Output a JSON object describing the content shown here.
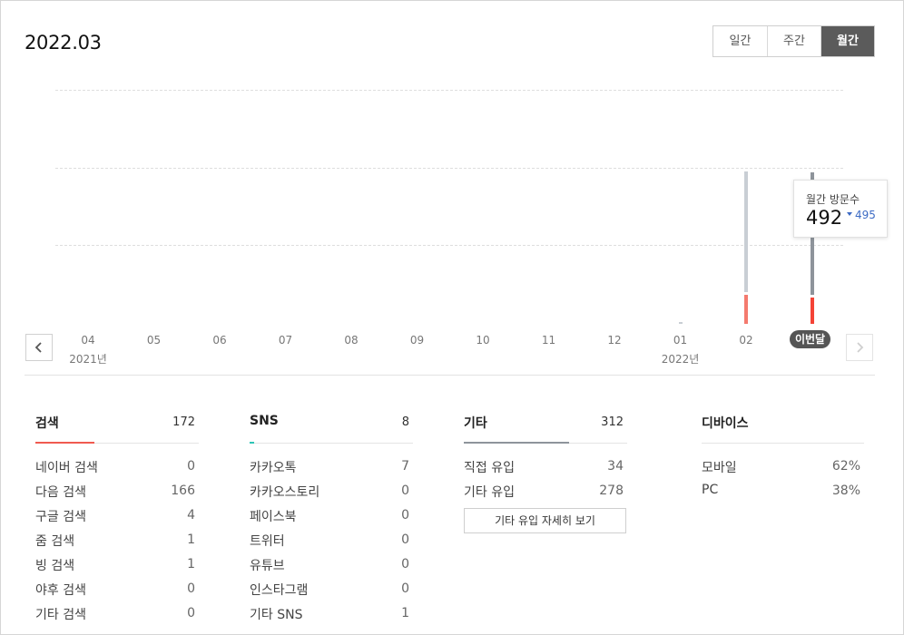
{
  "header": {
    "period": "2022.03",
    "tabs": [
      {
        "label": "일간",
        "active": false
      },
      {
        "label": "주간",
        "active": false
      },
      {
        "label": "월간",
        "active": true
      }
    ]
  },
  "chart_data": {
    "type": "bar",
    "categories": [
      "04",
      "05",
      "06",
      "07",
      "08",
      "09",
      "10",
      "11",
      "12",
      "01",
      "02",
      "이번달"
    ],
    "year_labels": {
      "04": "2021년",
      "01": "2022년"
    },
    "series": [
      {
        "color": "#c9ced4",
        "values": [
          0,
          0,
          0,
          0,
          0,
          0,
          0,
          0,
          0,
          1,
          495,
          492
        ]
      },
      {
        "color": "#f47a6e",
        "values": [
          0,
          0,
          0,
          0,
          0,
          0,
          0,
          0,
          0,
          0,
          95,
          85
        ]
      }
    ],
    "highlight_color": "#f44336",
    "current_bar_color": "#8e949b",
    "grid": true
  },
  "tooltip": {
    "label": "월간 방문수",
    "value": "492",
    "delta": "495"
  },
  "current_badge": "이번달",
  "nav": {
    "prev": "chevron-left",
    "next": "chevron-right"
  },
  "sections": {
    "search": {
      "title": "검색",
      "total": "172",
      "accent": "#f05a4f",
      "rows": [
        {
          "label": "네이버 검색",
          "value": "0"
        },
        {
          "label": "다음 검색",
          "value": "166"
        },
        {
          "label": "구글 검색",
          "value": "4"
        },
        {
          "label": "줌 검색",
          "value": "1"
        },
        {
          "label": "빙 검색",
          "value": "1"
        },
        {
          "label": "야후 검색",
          "value": "0"
        },
        {
          "label": "기타 검색",
          "value": "0"
        }
      ]
    },
    "sns": {
      "title": "SNS",
      "total": "8",
      "accent": "#2ec4b6",
      "rows": [
        {
          "label": "카카오톡",
          "value": "7"
        },
        {
          "label": "카카오스토리",
          "value": "0"
        },
        {
          "label": "페이스북",
          "value": "0"
        },
        {
          "label": "트위터",
          "value": "0"
        },
        {
          "label": "유튜브",
          "value": "0"
        },
        {
          "label": "인스타그램",
          "value": "0"
        },
        {
          "label": "기타 SNS",
          "value": "1"
        }
      ]
    },
    "etc": {
      "title": "기타",
      "total": "312",
      "accent": "#8e949b",
      "rows": [
        {
          "label": "직접 유입",
          "value": "34"
        },
        {
          "label": "기타 유입",
          "value": "278"
        }
      ],
      "detail_button": "기타 유입 자세히 보기"
    },
    "device": {
      "title": "디바이스",
      "rows": [
        {
          "label": "모바일",
          "value": "62%"
        },
        {
          "label": "PC",
          "value": "38%"
        }
      ]
    }
  }
}
